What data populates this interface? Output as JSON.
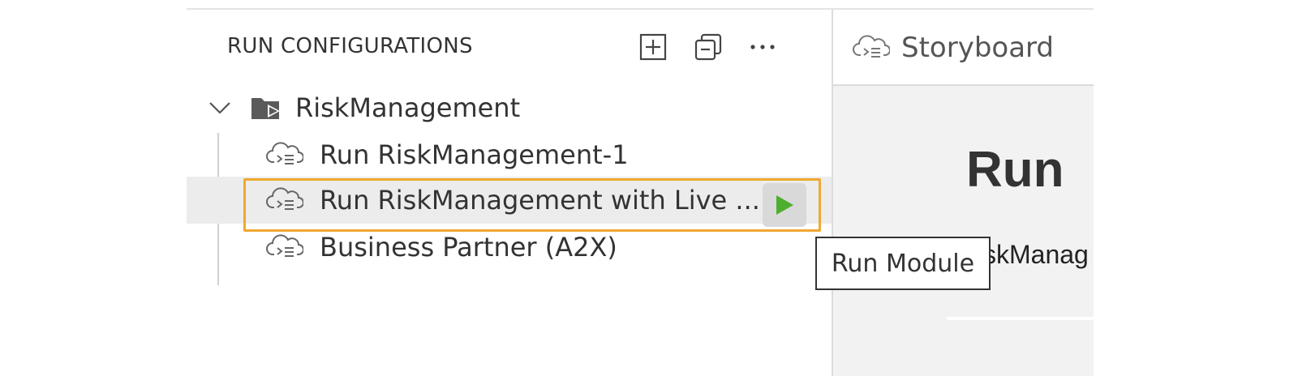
{
  "sidebar": {
    "title": "RUN CONFIGURATIONS",
    "header_icons": [
      "add-config-icon",
      "collapse-all-icon",
      "more-actions-icon"
    ],
    "tree": {
      "root": {
        "label": "RiskManagement",
        "icon": "folder-run-icon",
        "expanded": true
      },
      "items": [
        {
          "label": "Run RiskManagement-1",
          "icon": "cloud-run-icon",
          "selected": false
        },
        {
          "label": "Run RiskManagement with Live ...",
          "icon": "cloud-run-icon",
          "selected": true
        },
        {
          "label": "Business Partner (A2X)",
          "icon": "cloud-run-icon",
          "selected": false
        }
      ]
    },
    "run_button_icon": "play-icon"
  },
  "tooltip": {
    "text": "Run Module"
  },
  "editor": {
    "tab": {
      "label": "Storyboard",
      "icon": "cloud-run-icon"
    },
    "content": {
      "title": "Run",
      "subtitle_fragment": "skManag"
    }
  },
  "colors": {
    "highlight": "#f0a830",
    "play": "#4caf2e",
    "selected_row": "#ececec"
  }
}
